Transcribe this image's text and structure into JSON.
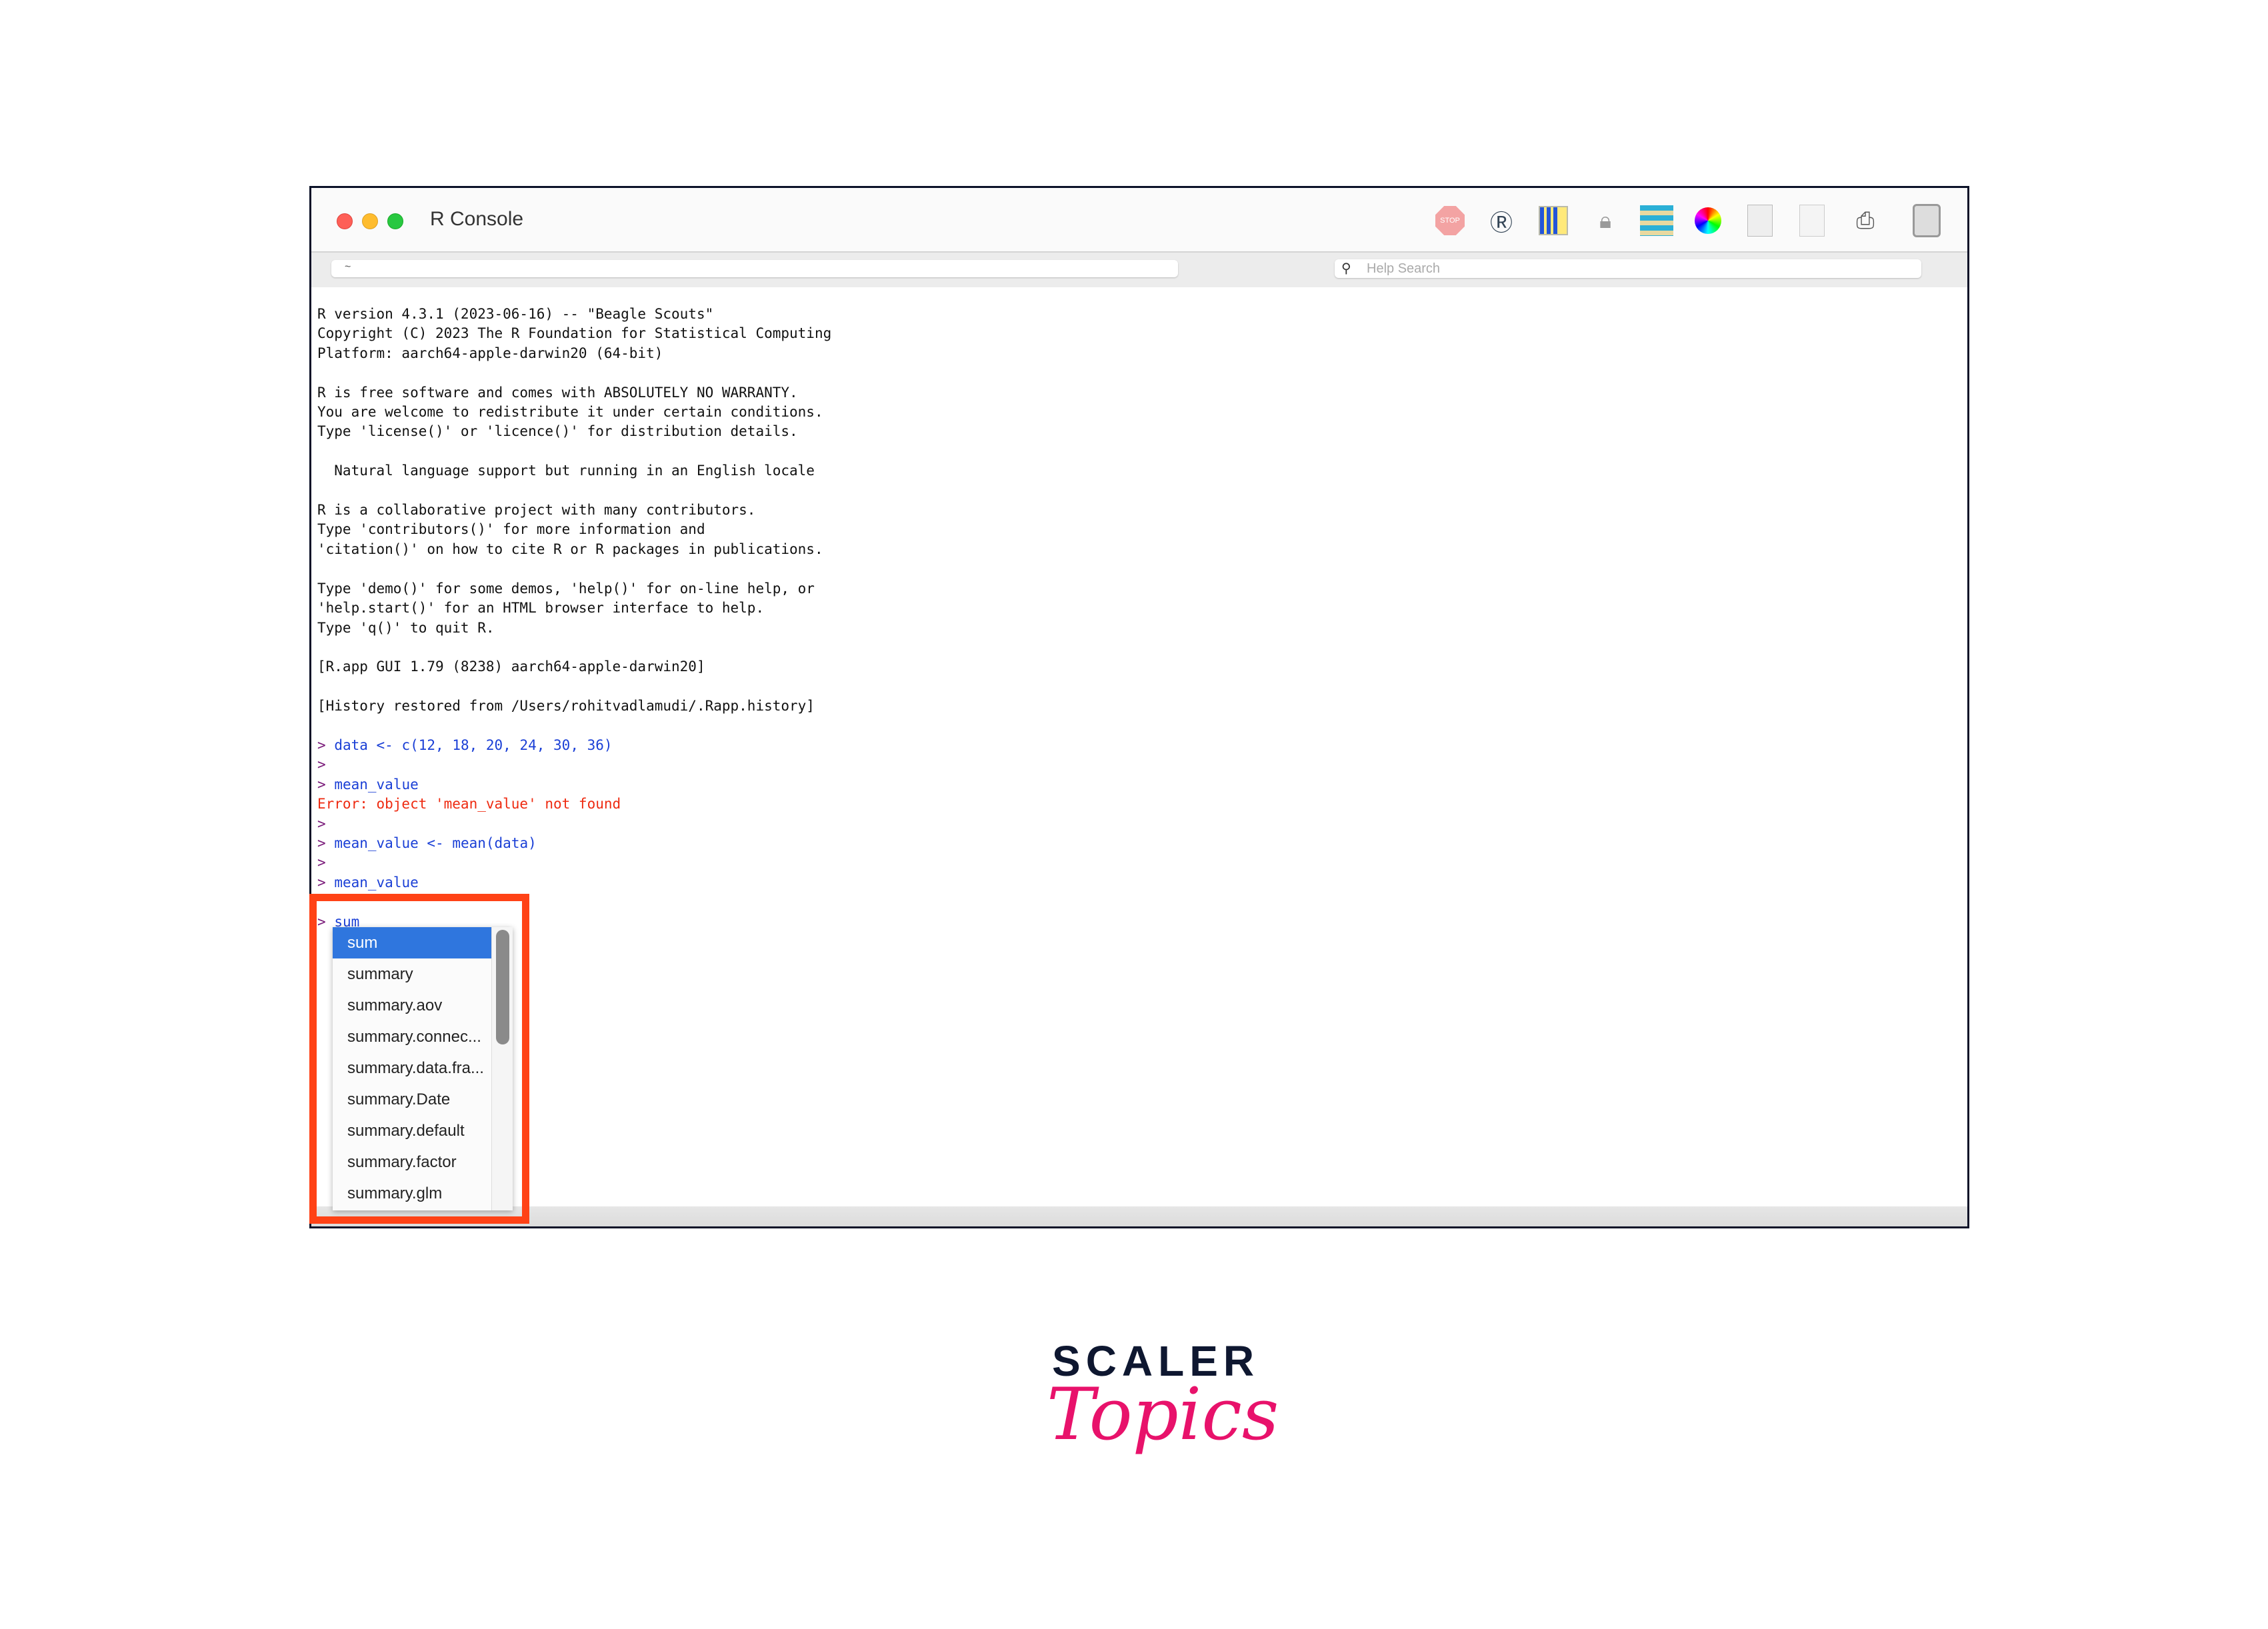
{
  "window": {
    "title": "R Console",
    "path_value": "~",
    "search_placeholder": "Help Search"
  },
  "toolbar_icons": [
    "stop-icon",
    "source-script-icon",
    "quartz-graphics-icon",
    "lock-icon",
    "data-editor-icon",
    "color-wheel-icon",
    "r-document-icon",
    "new-document-icon",
    "print-icon",
    "sidebar-toggle-icon"
  ],
  "stop_label": "STOP",
  "console": {
    "intro": "R version 4.3.1 (2023-06-16) -- \"Beagle Scouts\"\nCopyright (C) 2023 The R Foundation for Statistical Computing\nPlatform: aarch64-apple-darwin20 (64-bit)\n\nR is free software and comes with ABSOLUTELY NO WARRANTY.\nYou are welcome to redistribute it under certain conditions.\nType 'license()' or 'licence()' for distribution details.\n\n  Natural language support but running in an English locale\n\nR is a collaborative project with many contributors.\nType 'contributors()' for more information and\n'citation()' on how to cite R or R packages in publications.\n\nType 'demo()' for some demos, 'help()' for on-line help, or\n'help.start()' for an HTML browser interface to help.\nType 'q()' to quit R.\n\n[R.app GUI 1.79 (8238) aarch64-apple-darwin20]\n\n[History restored from /Users/rohitvadlamudi/.Rapp.history]\n",
    "prompt": ">",
    "cmd1": "data <- c(12, 18, 20, 24, 30, 36)",
    "cmd2": "mean_value",
    "error": "Error: object 'mean_value' not found",
    "cmd3": "mean_value <- mean(data)",
    "cmd4": "mean_value",
    "cmd5": "sum"
  },
  "autocomplete": [
    "sum",
    "summary",
    "summary.aov",
    "summary.connec...",
    "summary.data.fra...",
    "summary.Date",
    "summary.default",
    "summary.factor",
    "summary.glm"
  ],
  "logo": {
    "line1": "SCALER",
    "line2": "Topics"
  },
  "colors": {
    "command": "#1a3fd6",
    "error": "#ee2a10",
    "highlight": "#ff4216",
    "selection": "#2f76de",
    "brand": "#e8126b"
  }
}
